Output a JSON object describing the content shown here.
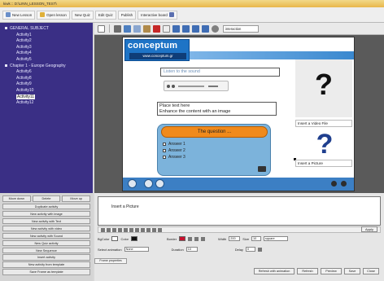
{
  "window": {
    "title": "kiwk :: D:\\LINN_LESSON_TEST\\"
  },
  "menu": {
    "new_lesson": "New Lesson",
    "open_lesson": "Open lesson",
    "new_quiz": "New Quiz",
    "edit_quiz": "Edit Quiz",
    "publish": "Publish",
    "interactive_board": "Interactive board"
  },
  "toolbar": {
    "mode_select": "interaction"
  },
  "tree": {
    "items": [
      {
        "label": "GENERAL SUBJECT",
        "level": 0,
        "selected": false
      },
      {
        "label": "Activity1",
        "level": 1,
        "selected": false
      },
      {
        "label": "Activity2",
        "level": 1,
        "selected": false
      },
      {
        "label": "Activity3",
        "level": 1,
        "selected": false
      },
      {
        "label": "Activity4",
        "level": 1,
        "selected": false
      },
      {
        "label": "Activity5",
        "level": 1,
        "selected": false
      },
      {
        "label": "Chapter 1 - Europe Geography",
        "level": 0,
        "selected": false
      },
      {
        "label": "Activity6",
        "level": 1,
        "selected": false
      },
      {
        "label": "Activity8",
        "level": 1,
        "selected": false
      },
      {
        "label": "Activity9",
        "level": 1,
        "selected": false
      },
      {
        "label": "Activity10",
        "level": 1,
        "selected": false
      },
      {
        "label": "Activity11",
        "level": 1,
        "selected": true
      },
      {
        "label": "Activity12",
        "level": 1,
        "selected": false
      }
    ]
  },
  "side_buttons": {
    "move_down": "Move down",
    "delete": "Delete",
    "move_up": "Move up",
    "actions": [
      "Duplicate activity",
      "New activity with image",
      "New activity with Text",
      "New activity with video",
      "New activity with Sound",
      "New Quiz activity",
      "New Sequence",
      "Insert activity",
      "New activity from template",
      "Save Frame as template"
    ]
  },
  "slide": {
    "logo_main": "conceptum",
    "logo_url": "www.conceptum.gr",
    "listen_label": "Listen to the sound",
    "text_line1": "Place text here",
    "text_line2": "Enhance the content with an image",
    "quiz_title": "The question ...",
    "answers": [
      "Answer 1",
      "Answer 2",
      "Answer 3"
    ],
    "video_mark": "?",
    "video_label": "Insert a Video File",
    "picture_mark": "?",
    "picture_label": "Insert a Picture"
  },
  "props": {
    "editor_text": "Insert a Picture",
    "apply": "Apply",
    "bgcolor_label": "BgColor",
    "color_label": "Color",
    "border_label": "Border",
    "width_label": "Width",
    "width_value": "200",
    "size_label": "Size",
    "size_value": "10",
    "font_value": "square",
    "select_animation_label": "Select animation",
    "animation_value": "None",
    "duration_label": "Duration",
    "duration_value": "10",
    "delay_label": "Delay",
    "delay_value": "0",
    "tab_label": "Frame properties",
    "refresh_animation": "Refresh with animation",
    "refresh": "Refresh",
    "preview": "Preview",
    "save": "Save",
    "close": "Close"
  }
}
